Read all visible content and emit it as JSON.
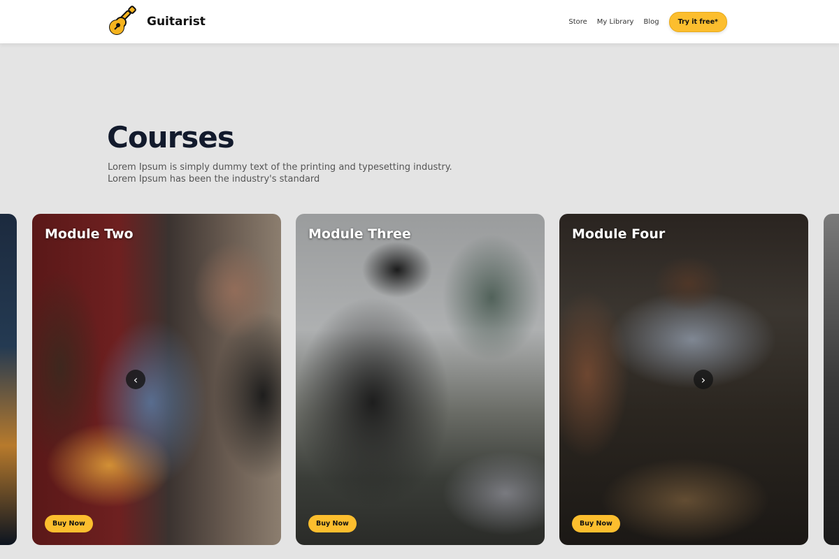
{
  "header": {
    "brand": "Guitarist",
    "nav": [
      "Store",
      "My Library",
      "Blog"
    ],
    "cta": "Try it free*"
  },
  "hero": {
    "title": "Courses",
    "description_line1": "Lorem Ipsum is simply dummy text of the printing and typesetting industry.",
    "description_line2": "Lorem Ipsum has been the industry's standard"
  },
  "carousel": {
    "prev_arrow": "‹",
    "next_arrow": "›",
    "cards": [
      {
        "title": "Module Two",
        "button": "Buy Now"
      },
      {
        "title": "Module Three",
        "button": "Buy Now"
      },
      {
        "title": "Module Four",
        "button": "Buy Now"
      }
    ]
  },
  "colors": {
    "accent": "#fcbe2e",
    "page_bg": "#e4e4e4",
    "title": "#121a2c"
  }
}
